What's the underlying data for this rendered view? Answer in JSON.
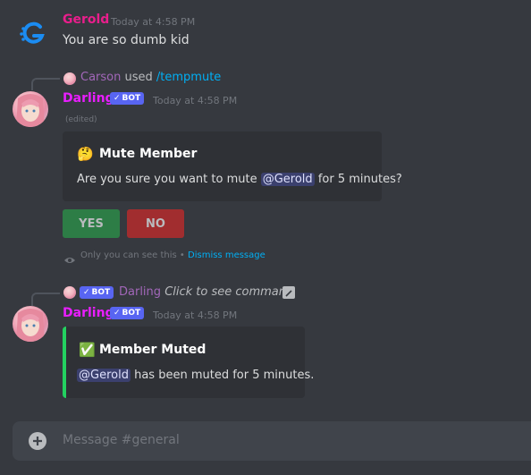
{
  "messages": {
    "gerold": {
      "author": "Gerold",
      "author_color": "#e91e8c",
      "timestamp": "Today at 4:58 PM",
      "text": "You are so dumb kid"
    },
    "darling1": {
      "reply_user": "Carson",
      "reply_used": "used",
      "reply_command": "/tempmute",
      "author": "Darling",
      "author_color": "#e91eff",
      "bot_label": "BOT",
      "timestamp": "Today at 4:58 PM",
      "edited": "(edited)",
      "embed": {
        "emoji": "🤔",
        "title": "Mute Member",
        "text_before": "Are you sure you want to mute",
        "mention": "@Gerold",
        "text_after": "for 5 minutes?"
      },
      "buttons": {
        "yes": "YES",
        "no": "NO"
      },
      "ephemeral_note": "Only you can see this",
      "ephemeral_sep": "•",
      "dismiss": "Dismiss message"
    },
    "darling2": {
      "reply_bot_label": "BOT",
      "reply_user": "Darling",
      "reply_text": "Click to see command",
      "author": "Darling",
      "bot_label": "BOT",
      "timestamp": "Today at 4:58 PM",
      "embed": {
        "emoji": "✅",
        "title": "Member Muted",
        "mention": "@Gerold",
        "text_after": "has been muted for 5 minutes.",
        "accent": "#23d160"
      }
    }
  },
  "composer": {
    "placeholder": "Message #general",
    "add_icon": "plus-circle-icon"
  },
  "colors": {
    "background": "#36393f",
    "embed": "#2f3136",
    "yes": "#3ba55d",
    "no": "#ed4245",
    "link": "#00aff4"
  }
}
